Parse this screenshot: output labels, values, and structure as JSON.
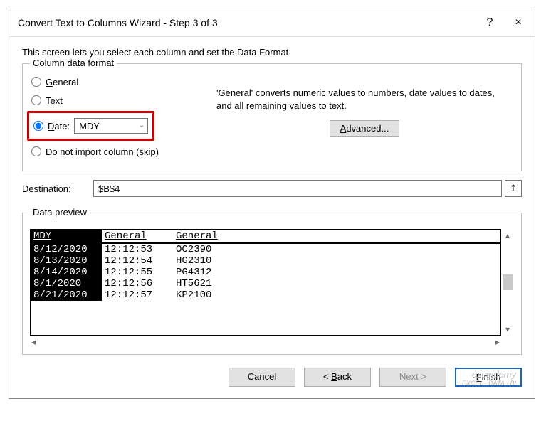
{
  "titlebar": {
    "title": "Convert Text to Columns Wizard - Step 3 of 3",
    "help": "?",
    "close": "×"
  },
  "intro": "This screen lets you select each column and set the Data Format.",
  "format": {
    "legend": "Column data format",
    "general_prefix": "G",
    "general_rest": "eneral",
    "text_prefix": "T",
    "text_rest": "ext",
    "date_prefix": "D",
    "date_rest": "ate:",
    "date_value": "MDY",
    "skip": "Do not import column (skip)",
    "hint": "'General' converts numeric values to numbers, date values to dates, and all remaining values to text.",
    "advanced_prefix": "A",
    "advanced_rest": "dvanced..."
  },
  "destination": {
    "label_prefix": "D",
    "label_rest": "estination:",
    "value": "$B$4"
  },
  "preview": {
    "legend_prefix": "Data p",
    "legend_ul": "r",
    "legend_rest": "eview",
    "headers": {
      "c1": "MDY",
      "c2": "General",
      "c3": "General"
    },
    "rows": [
      {
        "c1": "8/12/2020",
        "c2": "12:12:53",
        "c3": "OC2390"
      },
      {
        "c1": "8/13/2020",
        "c2": "12:12:54",
        "c3": "HG2310"
      },
      {
        "c1": "8/14/2020",
        "c2": "12:12:55",
        "c3": "PG4312"
      },
      {
        "c1": "8/1/2020",
        "c2": "12:12:56",
        "c3": "HT5621"
      },
      {
        "c1": "8/21/2020",
        "c2": "12:12:57",
        "c3": "KP2100"
      }
    ]
  },
  "footer": {
    "cancel": "Cancel",
    "back_prefix": "< ",
    "back_ul": "B",
    "back_rest": "ack",
    "next_prefix": "N",
    "next_rest": "ext >",
    "finish_prefix": "F",
    "finish_rest": "inish"
  },
  "watermark": {
    "main": "exceldemy",
    "sub": "EXCEL · DATA · BI"
  }
}
